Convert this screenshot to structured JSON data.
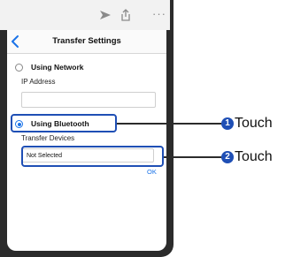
{
  "toolbar": {
    "send_icon": "send-icon",
    "share_icon": "share-icon",
    "more_text": "···"
  },
  "header": {
    "back_icon": "chevron-left-icon",
    "title": "Transfer Settings"
  },
  "network_option": {
    "label": "Using Network",
    "selected": false,
    "ip_label": "IP Address",
    "ip_value": ""
  },
  "bluetooth_option": {
    "label": "Using Bluetooth",
    "selected": true,
    "devices_label": "Transfer Devices",
    "devices_value": "Not Selected"
  },
  "ok_label": "OK",
  "callouts": [
    {
      "number": "1",
      "text": "Touch"
    },
    {
      "number": "2",
      "text": "Touch"
    }
  ],
  "colors": {
    "accent": "#1a73e8",
    "callout": "#1f4fb5"
  }
}
